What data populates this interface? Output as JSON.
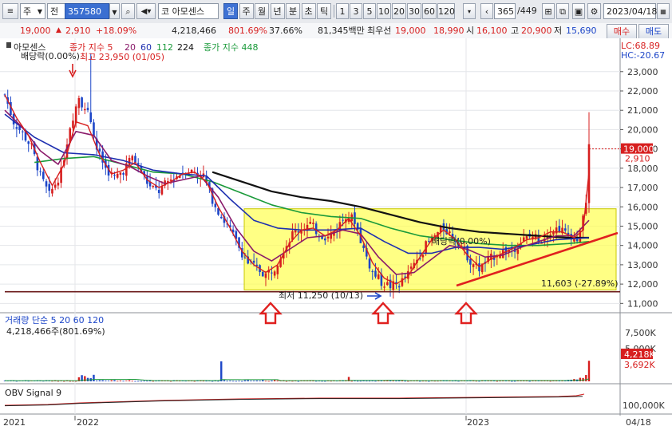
{
  "toolbar": {
    "market_select": "주",
    "item_select": "전",
    "stock_code": "357580",
    "market_prefix": "코",
    "stock_name": "아모센스",
    "periods": [
      "일",
      "주",
      "월",
      "년",
      "분",
      "초",
      "틱"
    ],
    "active_period": "일",
    "intervals": [
      "1",
      "3",
      "5",
      "10",
      "20",
      "30",
      "60",
      "120"
    ],
    "count": "365",
    "total": "/449",
    "date": "2023/04/18"
  },
  "infobar": {
    "price": "19,000",
    "change": "2,910",
    "change_pct": "+18.09%",
    "volume": "4,218,466",
    "volume_pct": "801.69%",
    "turnover": "37.66%",
    "amount": "81,345백만",
    "priority_label": "최우선",
    "bid1": "19,000",
    "bid2": "18,990",
    "open_label": "시",
    "open": "16,100",
    "high_label": "고",
    "high": "20,900",
    "low_label": "저",
    "low": "15,690",
    "buy": "매수",
    "sell": "매도"
  },
  "colors": {
    "ma5": "#d71f1f",
    "ma20": "#8a1a6a",
    "ma60": "#1d2fb0",
    "ma112": "#1a9a3a",
    "ma224": "#111111",
    "ma448": "#1a9a3a",
    "box": "#ffff55",
    "annotation": "#e0201f",
    "candle_up": "#d71f1f",
    "candle_down": "#1d46c8"
  },
  "chart_data": [
    {
      "type": "candlestick",
      "title": "아모센스",
      "legend": [
        "종가 지수 5",
        "20",
        "60",
        "112",
        "224",
        "종가 지수 448"
      ],
      "y_ticks": [
        "23,000",
        "22,000",
        "21,000",
        "20,000",
        "19,000",
        "18,000",
        "17,000",
        "16,000",
        "15,000",
        "14,000",
        "13,000",
        "12,000",
        "11,000"
      ],
      "ylim": [
        10600,
        23900
      ],
      "x_labels": [
        "2021",
        "2022",
        "2023",
        "04/18"
      ],
      "lc": "LC:68.89",
      "hc": "HC:-20.67",
      "current_price": "19,000",
      "current_change": "2,910",
      "high_marker": "최고 23,950 (01/05)",
      "low_marker": "최저 11,250 (10/13)",
      "support_label": "11,603 (-27.89%)",
      "dividend_labels": [
        "배당락(0.00%)",
        "배당락(0.00%)"
      ],
      "series_shape": {
        "close": [
          [
            0,
            21800
          ],
          [
            3,
            20400
          ],
          [
            6,
            19800
          ],
          [
            9,
            19100
          ],
          [
            12,
            17600
          ],
          [
            15,
            16600
          ],
          [
            19,
            17800
          ],
          [
            22,
            20200
          ],
          [
            25,
            21700
          ],
          [
            28,
            20800
          ],
          [
            31,
            19000
          ],
          [
            34,
            18000
          ],
          [
            37,
            17500
          ],
          [
            40,
            17900
          ],
          [
            43,
            18600
          ],
          [
            46,
            17800
          ],
          [
            49,
            17000
          ],
          [
            52,
            16800
          ],
          [
            55,
            17300
          ],
          [
            58,
            17600
          ],
          [
            61,
            17900
          ],
          [
            64,
            17800
          ],
          [
            67,
            17600
          ],
          [
            70,
            16400
          ],
          [
            73,
            15500
          ],
          [
            76,
            14800
          ],
          [
            79,
            13900
          ],
          [
            82,
            13100
          ],
          [
            85,
            12800
          ],
          [
            88,
            12500
          ],
          [
            91,
            12900
          ],
          [
            94,
            13800
          ],
          [
            97,
            14600
          ],
          [
            100,
            14900
          ],
          [
            103,
            15100
          ],
          [
            106,
            14600
          ],
          [
            109,
            14400
          ],
          [
            112,
            14900
          ],
          [
            115,
            15600
          ],
          [
            118,
            15300
          ],
          [
            121,
            13800
          ],
          [
            124,
            12600
          ],
          [
            127,
            12100
          ],
          [
            130,
            11900
          ],
          [
            133,
            12000
          ],
          [
            136,
            12500
          ],
          [
            139,
            13300
          ],
          [
            142,
            14000
          ],
          [
            145,
            14500
          ],
          [
            148,
            14900
          ],
          [
            151,
            14500
          ],
          [
            154,
            14000
          ],
          [
            157,
            13200
          ],
          [
            160,
            12800
          ],
          [
            163,
            13200
          ],
          [
            166,
            13600
          ],
          [
            169,
            13700
          ],
          [
            172,
            13900
          ],
          [
            175,
            14300
          ],
          [
            178,
            14500
          ],
          [
            181,
            14300
          ],
          [
            184,
            14800
          ],
          [
            187,
            14900
          ],
          [
            190,
            14500
          ],
          [
            193,
            14400
          ],
          [
            196,
            16100
          ],
          [
            197,
            19000
          ]
        ],
        "ma5": [
          [
            0,
            21800
          ],
          [
            4,
            20600
          ],
          [
            8,
            19700
          ],
          [
            12,
            18300
          ],
          [
            16,
            17100
          ],
          [
            20,
            18200
          ],
          [
            24,
            20400
          ],
          [
            28,
            20200
          ],
          [
            32,
            18700
          ],
          [
            36,
            17700
          ],
          [
            40,
            17900
          ],
          [
            44,
            18300
          ],
          [
            48,
            17400
          ],
          [
            52,
            17000
          ],
          [
            56,
            17300
          ],
          [
            60,
            17700
          ],
          [
            64,
            17800
          ],
          [
            68,
            17300
          ],
          [
            72,
            16000
          ],
          [
            76,
            14900
          ],
          [
            80,
            13700
          ],
          [
            84,
            13000
          ],
          [
            88,
            12600
          ],
          [
            92,
            13000
          ],
          [
            96,
            14100
          ],
          [
            100,
            14800
          ],
          [
            104,
            14900
          ],
          [
            108,
            14500
          ],
          [
            112,
            14800
          ],
          [
            116,
            15400
          ],
          [
            120,
            14500
          ],
          [
            124,
            13100
          ],
          [
            128,
            12300
          ],
          [
            132,
            12000
          ],
          [
            136,
            12400
          ],
          [
            140,
            13400
          ],
          [
            144,
            14300
          ],
          [
            148,
            14800
          ],
          [
            152,
            14300
          ],
          [
            156,
            13500
          ],
          [
            160,
            12900
          ],
          [
            164,
            13300
          ],
          [
            168,
            13600
          ],
          [
            172,
            13900
          ],
          [
            176,
            14300
          ],
          [
            180,
            14400
          ],
          [
            184,
            14700
          ],
          [
            188,
            14700
          ],
          [
            192,
            14400
          ],
          [
            195,
            14800
          ],
          [
            197,
            17800
          ]
        ],
        "ma20": [
          [
            0,
            21000
          ],
          [
            6,
            20100
          ],
          [
            12,
            18900
          ],
          [
            18,
            18200
          ],
          [
            24,
            19900
          ],
          [
            30,
            19700
          ],
          [
            36,
            18400
          ],
          [
            42,
            18100
          ],
          [
            48,
            17600
          ],
          [
            54,
            17200
          ],
          [
            60,
            17400
          ],
          [
            66,
            17600
          ],
          [
            72,
            16500
          ],
          [
            78,
            14900
          ],
          [
            84,
            13700
          ],
          [
            90,
            13200
          ],
          [
            96,
            13800
          ],
          [
            102,
            14400
          ],
          [
            108,
            14500
          ],
          [
            114,
            14800
          ],
          [
            120,
            14600
          ],
          [
            126,
            13400
          ],
          [
            132,
            12500
          ],
          [
            138,
            12600
          ],
          [
            144,
            13300
          ],
          [
            150,
            14000
          ],
          [
            156,
            13800
          ],
          [
            162,
            13400
          ],
          [
            168,
            13500
          ],
          [
            174,
            13900
          ],
          [
            180,
            14200
          ],
          [
            186,
            14500
          ],
          [
            192,
            14500
          ],
          [
            197,
            15300
          ]
        ],
        "ma60": [
          [
            0,
            20800
          ],
          [
            10,
            19600
          ],
          [
            20,
            18800
          ],
          [
            30,
            18700
          ],
          [
            40,
            18400
          ],
          [
            50,
            17900
          ],
          [
            60,
            17700
          ],
          [
            68,
            17600
          ],
          [
            76,
            16400
          ],
          [
            84,
            15300
          ],
          [
            92,
            14900
          ],
          [
            100,
            14800
          ],
          [
            110,
            14800
          ],
          [
            120,
            14900
          ],
          [
            128,
            14200
          ],
          [
            136,
            13600
          ],
          [
            144,
            13600
          ],
          [
            152,
            13900
          ],
          [
            160,
            13900
          ],
          [
            168,
            13800
          ],
          [
            176,
            14000
          ],
          [
            186,
            14300
          ],
          [
            197,
            14400
          ]
        ],
        "ma112": [
          [
            10,
            18300
          ],
          [
            20,
            18500
          ],
          [
            30,
            18600
          ],
          [
            40,
            18200
          ],
          [
            50,
            17800
          ],
          [
            60,
            17700
          ],
          [
            70,
            17300
          ],
          [
            80,
            16700
          ],
          [
            90,
            16100
          ],
          [
            100,
            15700
          ],
          [
            110,
            15500
          ],
          [
            120,
            15400
          ],
          [
            130,
            14900
          ],
          [
            140,
            14500
          ],
          [
            150,
            14300
          ],
          [
            160,
            14100
          ],
          [
            170,
            14000
          ],
          [
            180,
            14000
          ],
          [
            190,
            14100
          ],
          [
            197,
            14200
          ]
        ],
        "ma224": [
          [
            70,
            17800
          ],
          [
            80,
            17300
          ],
          [
            90,
            16800
          ],
          [
            100,
            16500
          ],
          [
            110,
            16300
          ],
          [
            120,
            16000
          ],
          [
            130,
            15600
          ],
          [
            140,
            15200
          ],
          [
            150,
            14900
          ],
          [
            160,
            14700
          ],
          [
            170,
            14600
          ],
          [
            180,
            14500
          ],
          [
            190,
            14400
          ],
          [
            197,
            14400
          ]
        ]
      }
    },
    {
      "type": "bar",
      "title": "거래량 단순 5 20 60 120",
      "value_label": "4,218,466주(801.69%)",
      "y_ticks": [
        "7,500K",
        "5,000K",
        "3,692K"
      ],
      "current": "4,218K",
      "ylim": [
        0,
        9000000
      ]
    },
    {
      "type": "line",
      "title": "OBV Signal 9",
      "y_ticks": [
        "100,000K"
      ]
    }
  ]
}
